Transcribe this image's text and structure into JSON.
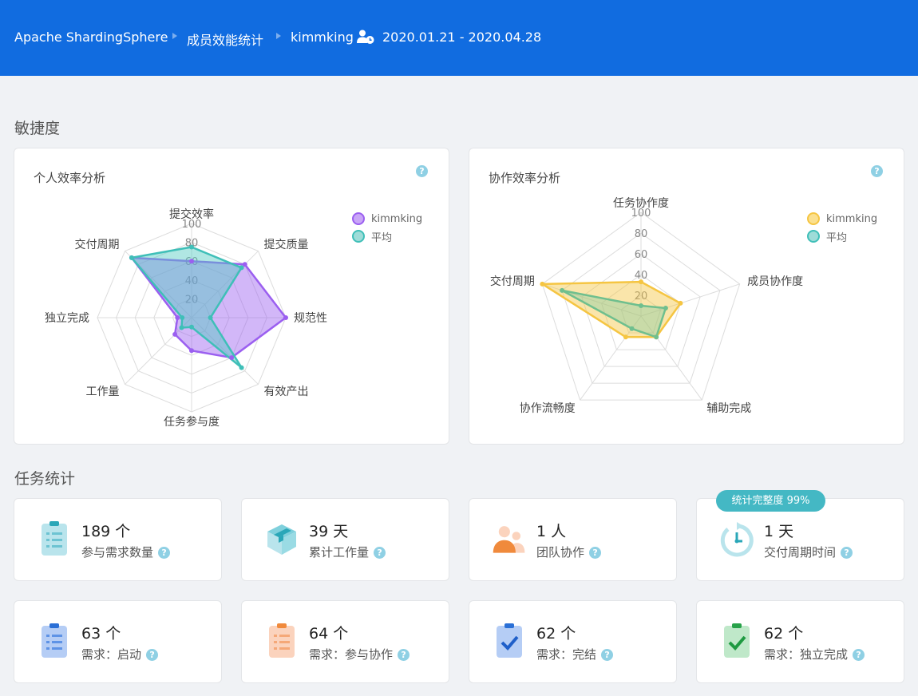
{
  "breadcrumb": {
    "project": "Apache ShardingSphere",
    "page": "成员效能统计",
    "member": "kimmking",
    "date_range": "2020.01.21 - 2020.04.28"
  },
  "sections": {
    "agility": "敏捷度",
    "tasks": "任务统计"
  },
  "colors": {
    "topbar": "#116ce0",
    "kimmking_personal": "#9b5ff0",
    "average": "#3fbfb8",
    "kimmking_collab": "#f5c542",
    "help": "#8fd0e4",
    "badge": "#44b8c4"
  },
  "legend": {
    "member": "kimmking",
    "average": "平均"
  },
  "help_icon": "?",
  "chart_data": [
    {
      "type": "radar",
      "title": "个人效率分析",
      "axes": [
        "提交效率",
        "提交质量",
        "规范性",
        "有效产出",
        "任务参与度",
        "工作量",
        "独立完成",
        "交付周期"
      ],
      "ticks": [
        "20",
        "40",
        "60",
        "80",
        "100"
      ],
      "range": [
        0,
        100
      ],
      "series": [
        {
          "name": "kimmking",
          "values": [
            60,
            80,
            100,
            60,
            35,
            25,
            15,
            90
          ]
        },
        {
          "name": "平均",
          "values": [
            75,
            75,
            20,
            75,
            10,
            15,
            10,
            90
          ]
        }
      ]
    },
    {
      "type": "radar",
      "title": "协作效率分析",
      "axes": [
        "任务协作度",
        "成员协作度",
        "辅助完成",
        "协作流畅度",
        "交付周期"
      ],
      "ticks": [
        "20",
        "40",
        "60",
        "80",
        "100"
      ],
      "range": [
        0,
        100
      ],
      "series": [
        {
          "name": "kimmking",
          "values": [
            33,
            40,
            25,
            25,
            100
          ]
        },
        {
          "name": "平均",
          "values": [
            10,
            25,
            25,
            15,
            80
          ]
        }
      ]
    }
  ],
  "stats": [
    {
      "value": "189 个",
      "label": "参与需求数量",
      "icon": "clipboard-list-icon"
    },
    {
      "value": "39 天",
      "label": "累计工作量",
      "icon": "cube-icon"
    },
    {
      "value": "1 人",
      "label": "团队协作",
      "icon": "team-icon"
    },
    {
      "value": "1 天",
      "label": "交付周期时间",
      "icon": "timer-icon"
    },
    {
      "value": "63 个",
      "label": "需求：启动",
      "icon": "clipboard-start-icon"
    },
    {
      "value": "64 个",
      "label": "需求：参与协作",
      "icon": "clipboard-collab-icon"
    },
    {
      "value": "62 个",
      "label": "需求：完结",
      "icon": "clipboard-check-icon"
    },
    {
      "value": "62 个",
      "label": "需求：独立完成",
      "icon": "clipboard-solo-icon"
    }
  ],
  "completeness_badge": "统计完整度 99%"
}
